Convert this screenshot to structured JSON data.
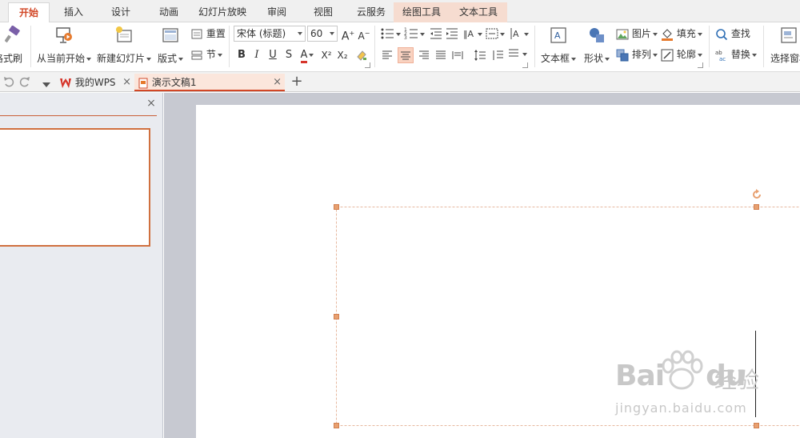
{
  "ribbon_tabs": [
    {
      "label": "开始",
      "active": true
    },
    {
      "label": "插入"
    },
    {
      "label": "设计"
    },
    {
      "label": "动画"
    },
    {
      "label": "幻灯片放映"
    },
    {
      "label": "审阅"
    },
    {
      "label": "视图"
    },
    {
      "label": "云服务"
    },
    {
      "label": "绘图工具",
      "contextual": true
    },
    {
      "label": "文本工具",
      "contextual": true
    }
  ],
  "ribbon": {
    "format_painter": "格式刷",
    "from_current": "从当前开始",
    "new_slide": "新建幻灯片",
    "layout": "版式",
    "reset": "重置",
    "section": "节",
    "font_name": "宋体 (标题)",
    "font_size": "60",
    "bold": "B",
    "italic": "I",
    "underline": "U",
    "strike": "S",
    "font_color": "A",
    "superscript": "X²",
    "subscript": "X₂",
    "text_box": "文本框",
    "shape": "形状",
    "picture": "图片",
    "arrange": "排列",
    "fill": "填充",
    "outline": "轮廓",
    "find": "查找",
    "replace": "替换",
    "select_pane": "选择窗格"
  },
  "doc_tabs": {
    "my_wps": "我的WPS",
    "current_doc": "演示文稿1",
    "new_tab": "+"
  },
  "watermark": {
    "brand_left": "Bai",
    "brand_right": "du",
    "brand_cn": "经验",
    "url": "jingyan.baidu.com"
  },
  "colors": {
    "accent": "#d24726",
    "selection_handle": "#e8a070",
    "thumb_border": "#d0703f"
  }
}
